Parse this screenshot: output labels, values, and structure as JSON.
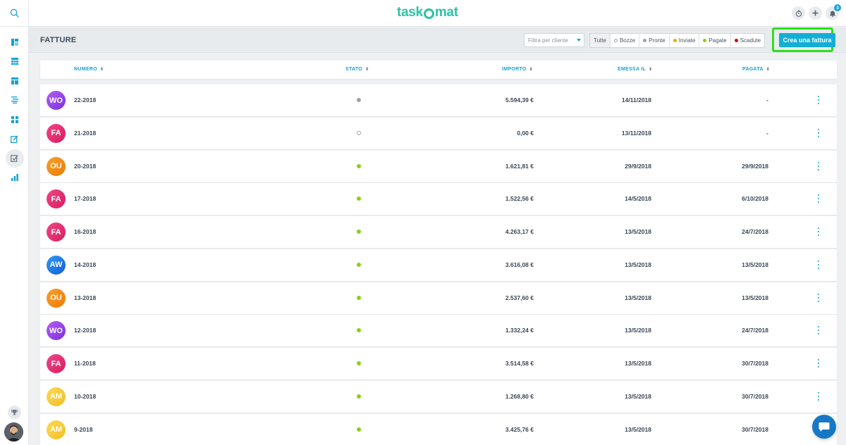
{
  "header": {
    "logo": "task",
    "logo_suffix": "mat",
    "notification_count": "3"
  },
  "sidebar": {
    "items": [
      {
        "icon": "dashboard-icon"
      },
      {
        "icon": "grid-icon"
      },
      {
        "icon": "projects-icon"
      },
      {
        "icon": "list-icon"
      },
      {
        "icon": "tiles-icon"
      },
      {
        "icon": "edit-icon"
      },
      {
        "icon": "invoice-check-icon",
        "active": true
      },
      {
        "icon": "bar-chart-icon"
      }
    ]
  },
  "subheader": {
    "title": "FATTURE",
    "client_filter_placeholder": "Filtra per cliente",
    "filters": [
      {
        "label": "Tutte",
        "dot": null,
        "active": true
      },
      {
        "label": "Bozze",
        "dot": "outline"
      },
      {
        "label": "Pronte",
        "dot": "#9aa2ab"
      },
      {
        "label": "Inviate",
        "dot": "#f0a500"
      },
      {
        "label": "Pagate",
        "dot": "#8ccf16"
      },
      {
        "label": "Scadute",
        "dot": "#d0021b"
      }
    ],
    "create_label": "Crea una fattura"
  },
  "table": {
    "headers": {
      "numero": "NUMERO",
      "stato": "STATO",
      "importo": "IMPORTO",
      "emessa": "EMESSA IL",
      "pagata": "PAGATA",
      "sort_glyph": "⬍"
    },
    "rows": [
      {
        "initials": "WO",
        "avatar_color": "purple",
        "numero": "22-2018",
        "status": "ready",
        "importo": "5.594,39 €",
        "emessa": "14/11/2018",
        "pagata": "-"
      },
      {
        "initials": "FA",
        "avatar_color": "pink",
        "numero": "21-2018",
        "status": "draft",
        "importo": "0,00 €",
        "emessa": "13/11/2018",
        "pagata": "-"
      },
      {
        "initials": "OU",
        "avatar_color": "orange",
        "numero": "20-2018",
        "status": "paid",
        "importo": "1.621,81 €",
        "emessa": "29/9/2018",
        "pagata": "29/9/2018"
      },
      {
        "initials": "FA",
        "avatar_color": "pink",
        "numero": "17-2018",
        "status": "paid",
        "importo": "1.522,56 €",
        "emessa": "14/5/2018",
        "pagata": "6/10/2018"
      },
      {
        "initials": "FA",
        "avatar_color": "pink",
        "numero": "16-2018",
        "status": "paid",
        "importo": "4.263,17 €",
        "emessa": "13/5/2018",
        "pagata": "24/7/2018"
      },
      {
        "initials": "AW",
        "avatar_color": "blue",
        "numero": "14-2018",
        "status": "paid",
        "importo": "3.616,08 €",
        "emessa": "13/5/2018",
        "pagata": "13/5/2018"
      },
      {
        "initials": "OU",
        "avatar_color": "orange",
        "numero": "13-2018",
        "status": "paid",
        "importo": "2.537,60 €",
        "emessa": "13/5/2018",
        "pagata": "13/5/2018"
      },
      {
        "initials": "WO",
        "avatar_color": "purple",
        "numero": "12-2018",
        "status": "paid",
        "importo": "1.332,24 €",
        "emessa": "13/5/2018",
        "pagata": "24/7/2018"
      },
      {
        "initials": "FA",
        "avatar_color": "pink",
        "numero": "11-2018",
        "status": "paid",
        "importo": "3.514,58 €",
        "emessa": "13/5/2018",
        "pagata": "30/7/2018"
      },
      {
        "initials": "AM",
        "avatar_color": "yellow",
        "numero": "10-2018",
        "status": "paid",
        "importo": "1.268,80 €",
        "emessa": "13/5/2018",
        "pagata": "30/7/2018"
      },
      {
        "initials": "AM",
        "avatar_color": "yellow",
        "numero": "9-2018",
        "status": "paid",
        "importo": "3.425,76 €",
        "emessa": "13/5/2018",
        "pagata": "30/7/2018"
      }
    ]
  },
  "colors": {
    "accent": "#13aed6",
    "brand": "#2fc1a5",
    "highlight": "#2fe01a",
    "status_ready": "#9aa2ab",
    "status_paid": "#8ccf16",
    "purple": "#9b3fe0",
    "pink": "#e8286f",
    "orange": "#f08a0c",
    "blue": "#1a75e6",
    "yellow": "#f6c733"
  }
}
